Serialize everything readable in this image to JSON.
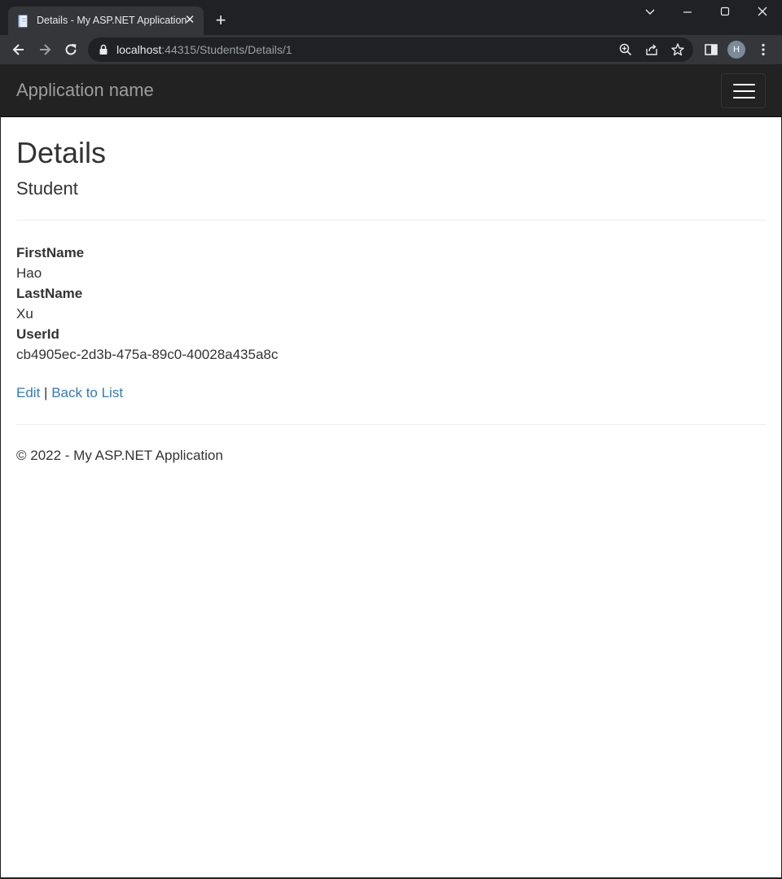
{
  "browser": {
    "tab_title": "Details - My ASP.NET Application",
    "url_host": "localhost",
    "url_path": ":44315/Students/Details/1",
    "profile_initial": "H"
  },
  "navbar": {
    "brand": "Application name"
  },
  "page": {
    "title": "Details",
    "subtitle": "Student",
    "fields": [
      {
        "label": "FirstName",
        "value": "Hao"
      },
      {
        "label": "LastName",
        "value": "Xu"
      },
      {
        "label": "UserId",
        "value": "cb4905ec-2d3b-475a-89c0-40028a435a8c"
      }
    ],
    "edit_link": "Edit",
    "separator": "|",
    "back_link": "Back to List",
    "footer": "© 2022 - My ASP.NET Application"
  },
  "colors": {
    "navbar_bg": "#222222",
    "link": "#337ab7",
    "text": "#333333"
  }
}
